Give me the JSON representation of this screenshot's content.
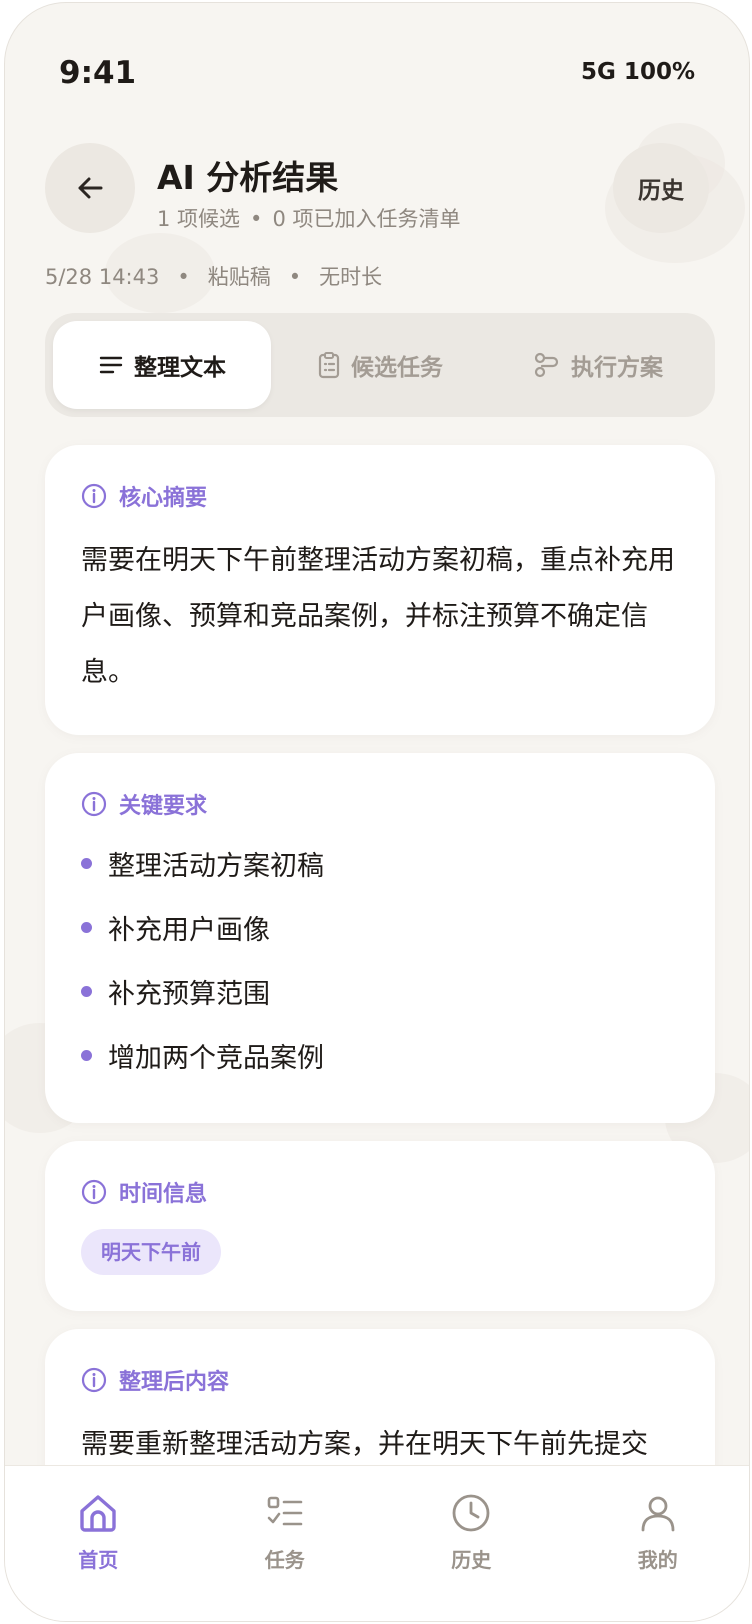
{
  "status": {
    "time": "9:41",
    "network": "5G 100%"
  },
  "header": {
    "title": "AI 分析结果",
    "subtitle_candidates": "1 项候选",
    "subtitle_sep": "•",
    "subtitle_added": "0 项已加入任务清单",
    "history_label": "历史"
  },
  "meta": {
    "datetime": "5/28 14:43",
    "sep": "•",
    "source": "粘贴稿",
    "duration": "无时长"
  },
  "tabs": [
    {
      "label": "整理文本",
      "icon": "text-lines-icon"
    },
    {
      "label": "候选任务",
      "icon": "clipboard-list-icon"
    },
    {
      "label": "执行方案",
      "icon": "route-icon"
    }
  ],
  "cards": {
    "summary": {
      "title": "核心摘要",
      "body": "需要在明天下午前整理活动方案初稿，重点补充用户画像、预算和竞品案例，并标注预算不确定信息。"
    },
    "requirements": {
      "title": "关键要求",
      "items": [
        "整理活动方案初稿",
        "补充用户画像",
        "补充预算范围",
        "增加两个竞品案例"
      ]
    },
    "time": {
      "title": "时间信息",
      "chip": "明天下午前"
    },
    "organized": {
      "title": "整理后内容",
      "body": "需要重新整理活动方案，并在明天下午前先提交"
    }
  },
  "nav": [
    {
      "label": "首页",
      "icon": "home-icon"
    },
    {
      "label": "任务",
      "icon": "tasks-icon"
    },
    {
      "label": "历史",
      "icon": "clock-icon"
    },
    {
      "label": "我的",
      "icon": "user-icon"
    }
  ],
  "colors": {
    "accent": "#8a72d8",
    "background": "#f7f5f1",
    "chip_bg": "#ebe6fb"
  }
}
